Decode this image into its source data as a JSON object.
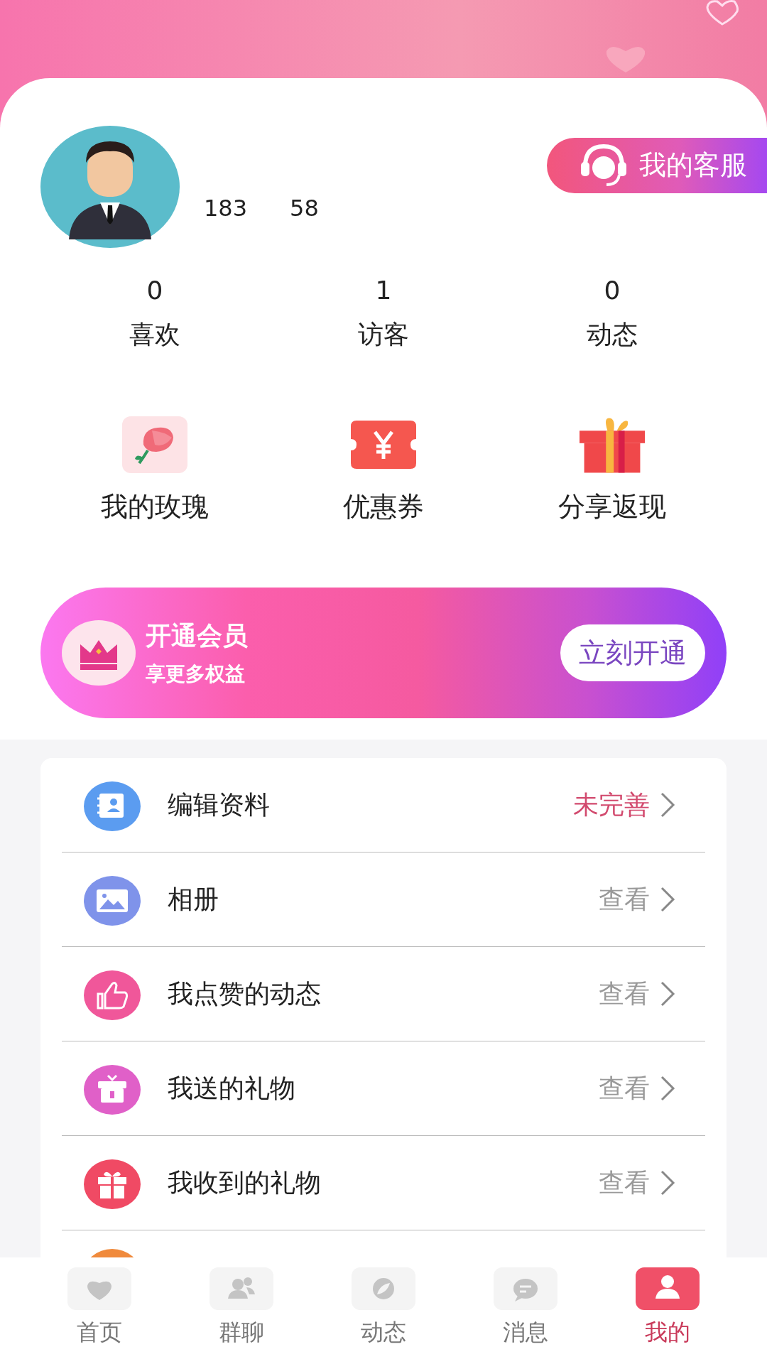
{
  "profile": {
    "id_prefix": "183",
    "id_suffix": "58",
    "service_button": "我的客服"
  },
  "stats": [
    {
      "value": "0",
      "label": "喜欢"
    },
    {
      "value": "1",
      "label": "访客"
    },
    {
      "value": "0",
      "label": "动态"
    }
  ],
  "shortcuts": [
    {
      "kind": "rose",
      "label": "我的玫瑰"
    },
    {
      "kind": "coupon",
      "label": "优惠券"
    },
    {
      "kind": "gift",
      "label": "分享返现"
    }
  ],
  "vip_banner": {
    "title": "开通会员",
    "subtitle": "享更多权益",
    "button": "立刻开通"
  },
  "menu": [
    {
      "kind": "contact",
      "color": "#5b9cf0",
      "label": "编辑资料",
      "status": "未完善",
      "alert": true
    },
    {
      "kind": "image",
      "color": "#7f93ea",
      "label": "相册",
      "status": "查看",
      "alert": false
    },
    {
      "kind": "thumb",
      "color": "#f0579a",
      "label": "我点赞的动态",
      "status": "查看",
      "alert": false
    },
    {
      "kind": "box",
      "color": "#e060c8",
      "label": "我送的礼物",
      "status": "查看",
      "alert": false
    },
    {
      "kind": "gift",
      "color": "#f04a64",
      "label": "我收到的礼物",
      "status": "查看",
      "alert": false
    },
    {
      "kind": "partial",
      "color": "#f08a3c"
    }
  ],
  "tab_bar": [
    {
      "kind": "heart",
      "label": "首页",
      "selected": false
    },
    {
      "kind": "group",
      "label": "群聊",
      "selected": false
    },
    {
      "kind": "leaf",
      "label": "动态",
      "selected": false
    },
    {
      "kind": "chat",
      "label": "消息",
      "selected": false
    },
    {
      "kind": "person",
      "label": "我的",
      "selected": true
    }
  ]
}
